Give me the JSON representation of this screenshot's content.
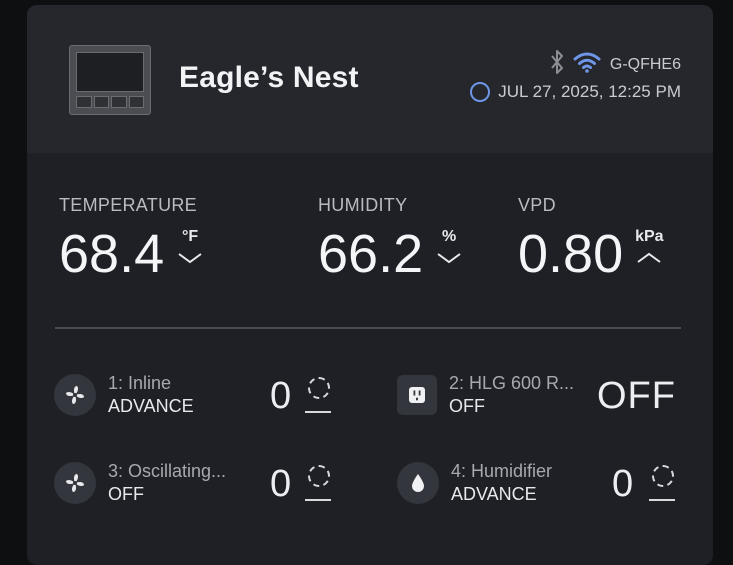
{
  "header": {
    "title": "Eagle’s Nest",
    "device_id": "G-QFHE6",
    "datetime": "JUL 27, 2025, 12:25 PM",
    "icons": [
      "device-thumbnail",
      "bluetooth-icon",
      "wifi-icon",
      "status-ring-icon"
    ]
  },
  "metrics": {
    "temperature": {
      "label": "TEMPERATURE",
      "value": "68.4",
      "unit": "°F",
      "trend": "down"
    },
    "humidity": {
      "label": "HUMIDITY",
      "value": "66.2",
      "unit": "%",
      "trend": "down"
    },
    "vpd": {
      "label": "VPD",
      "value": "0.80",
      "unit": "kPa",
      "trend": "up"
    }
  },
  "devices": [
    {
      "name": "1: Inline",
      "mode": "ADVANCE",
      "level": "0",
      "icon": "fan-icon"
    },
    {
      "name": "2: HLG 600 R...",
      "mode": "OFF",
      "level": "OFF",
      "icon": "outlet-icon"
    },
    {
      "name": "3: Oscillating...",
      "mode": "OFF",
      "level": "0",
      "icon": "fan-icon"
    },
    {
      "name": "4: Humidifier",
      "mode": "ADVANCE",
      "level": "0",
      "icon": "water-drop-icon"
    }
  ],
  "colors": {
    "background": "#0e0f11",
    "card": "#1e2025",
    "header": "#25272d",
    "wifi_accent": "#6f95e6"
  }
}
